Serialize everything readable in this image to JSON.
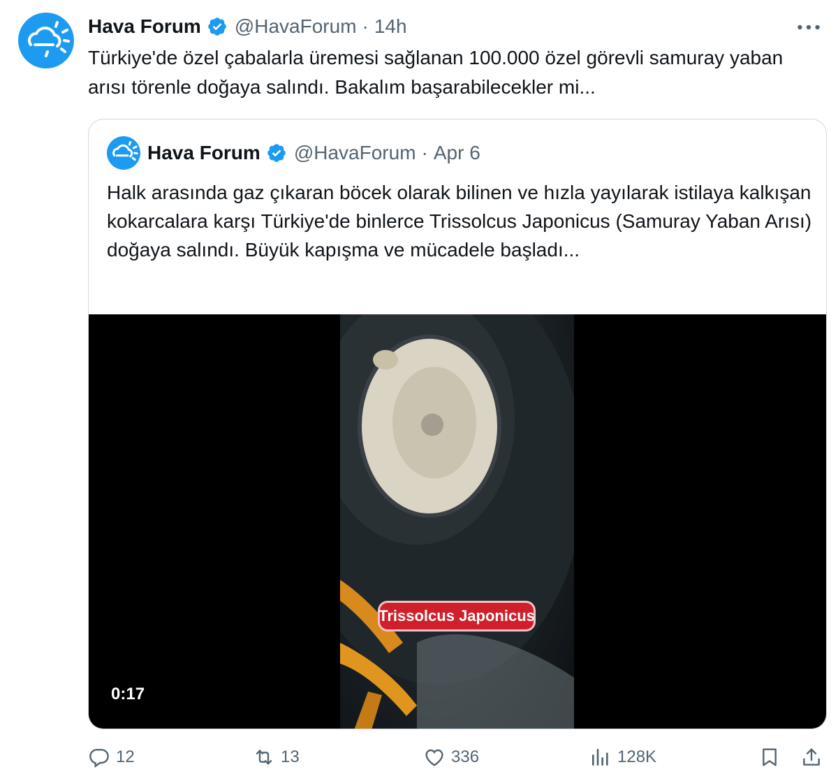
{
  "tweet": {
    "author_name": "Hava Forum",
    "handle": "@HavaForum",
    "separator": "·",
    "time": "14h",
    "text": "Türkiye'de özel çabalarla üremesi sağlanan 100.000 özel görevli samuray yaban arısı törenle doğaya salındı. Bakalım başarabilecekler mi...",
    "more_icon": "more-horizontal-icon",
    "verified_icon": "verified-badge-icon"
  },
  "quote": {
    "author_name": "Hava Forum",
    "handle": "@HavaForum",
    "separator": "·",
    "time": "Apr 6",
    "text": "Halk arasında gaz çıkaran böcek olarak bilinen ve hızla yayılarak istilaya kalkışan kokarcalara karşı Türkiye'de binlerce Trissolcus Japonicus (Samuray Yaban Arısı) doğaya salındı. Büyük kapışma ve mücadele başladı...",
    "video": {
      "caption": "Trissolcus Japonicus",
      "duration": "0:17"
    }
  },
  "actions": {
    "reply": {
      "icon": "reply-icon",
      "count": "12"
    },
    "repost": {
      "icon": "repost-icon",
      "count": "13"
    },
    "like": {
      "icon": "heart-icon",
      "count": "336"
    },
    "views": {
      "icon": "views-chart-icon",
      "count": "128K"
    },
    "bookmark": {
      "icon": "bookmark-icon"
    },
    "share": {
      "icon": "share-icon"
    }
  },
  "colors": {
    "brand_blue": "#1d9bf0",
    "text_primary": "#0f1419",
    "text_secondary": "#536471",
    "border": "#cfd9de",
    "caption_red": "#cf1f2b"
  }
}
